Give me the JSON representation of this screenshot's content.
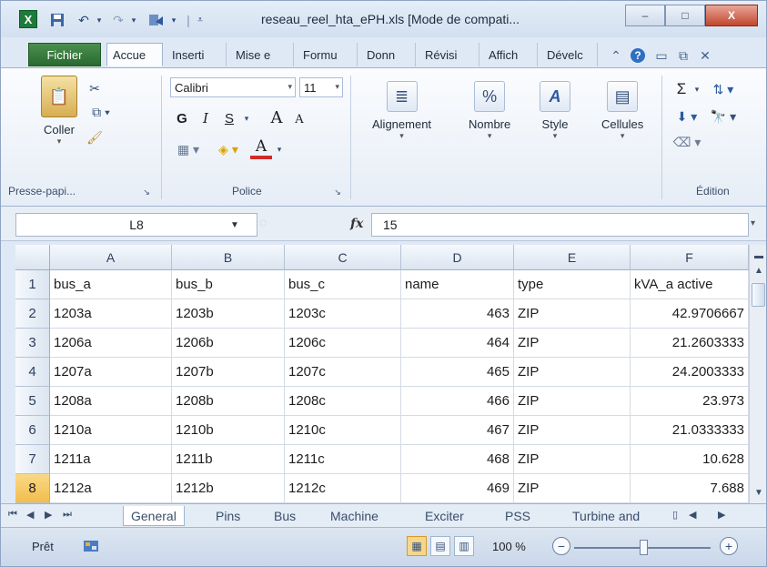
{
  "window": {
    "title": "reseau_reel_hta_ePH.xls  [Mode de compati...",
    "app_icon_letter": "X",
    "minimize": "–",
    "maximize": "□",
    "close": "X"
  },
  "quick_access": {
    "save_icon": "save-icon",
    "undo_icon": "undo-icon",
    "redo_icon": "redo-icon",
    "custom_icon": "customize-icon"
  },
  "ribbon_tabs": [
    "Fichier",
    "Accue",
    "Inserti",
    "Mise e",
    "Formu",
    "Donn",
    "Révisi",
    "Affich",
    "Dévelc"
  ],
  "ribbon": {
    "clipboard": {
      "paste_label": "Coller",
      "group_label": "Presse-papi..."
    },
    "font": {
      "font_name": "Calibri",
      "font_size": "11",
      "bold": "G",
      "italic": "I",
      "strike": "S",
      "grow": "A",
      "shrink": "A",
      "font_color": "A",
      "group_label": "Police"
    },
    "alignment_label": "Alignement",
    "number_label": "Nombre",
    "style_label": "Style",
    "cells_label": "Cellules",
    "editing_label": "Édition",
    "sigma": "Σ",
    "percent": "%"
  },
  "formula_bar": {
    "name_box": "L8",
    "fx": "fx",
    "value": "15"
  },
  "sheet": {
    "columns": [
      "A",
      "B",
      "C",
      "D",
      "E",
      "F"
    ],
    "rows": [
      {
        "n": "1",
        "cells": [
          "bus_a",
          "bus_b",
          "bus_c",
          "name",
          "type",
          "kVA_a active"
        ]
      },
      {
        "n": "2",
        "cells": [
          "1203a",
          "1203b",
          "1203c",
          "463",
          "ZIP",
          "42.9706667"
        ]
      },
      {
        "n": "3",
        "cells": [
          "1206a",
          "1206b",
          "1206c",
          "464",
          "ZIP",
          "21.2603333"
        ]
      },
      {
        "n": "4",
        "cells": [
          "1207a",
          "1207b",
          "1207c",
          "465",
          "ZIP",
          "24.2003333"
        ]
      },
      {
        "n": "5",
        "cells": [
          "1208a",
          "1208b",
          "1208c",
          "466",
          "ZIP",
          "23.973"
        ]
      },
      {
        "n": "6",
        "cells": [
          "1210a",
          "1210b",
          "1210c",
          "467",
          "ZIP",
          "21.0333333"
        ]
      },
      {
        "n": "7",
        "cells": [
          "1211a",
          "1211b",
          "1211c",
          "468",
          "ZIP",
          "10.628"
        ]
      },
      {
        "n": "8",
        "cells": [
          "1212a",
          "1212b",
          "1212c",
          "469",
          "ZIP",
          "7.688"
        ]
      }
    ],
    "selected_row": "8"
  },
  "sheet_tabs": [
    "General",
    "Pins",
    "Bus",
    "Machine",
    "Exciter",
    "PSS",
    "Turbine and"
  ],
  "active_sheet": "General",
  "status": {
    "text": "Prêt",
    "zoom": "100 %",
    "zoom_out": "−",
    "zoom_in": "+"
  }
}
